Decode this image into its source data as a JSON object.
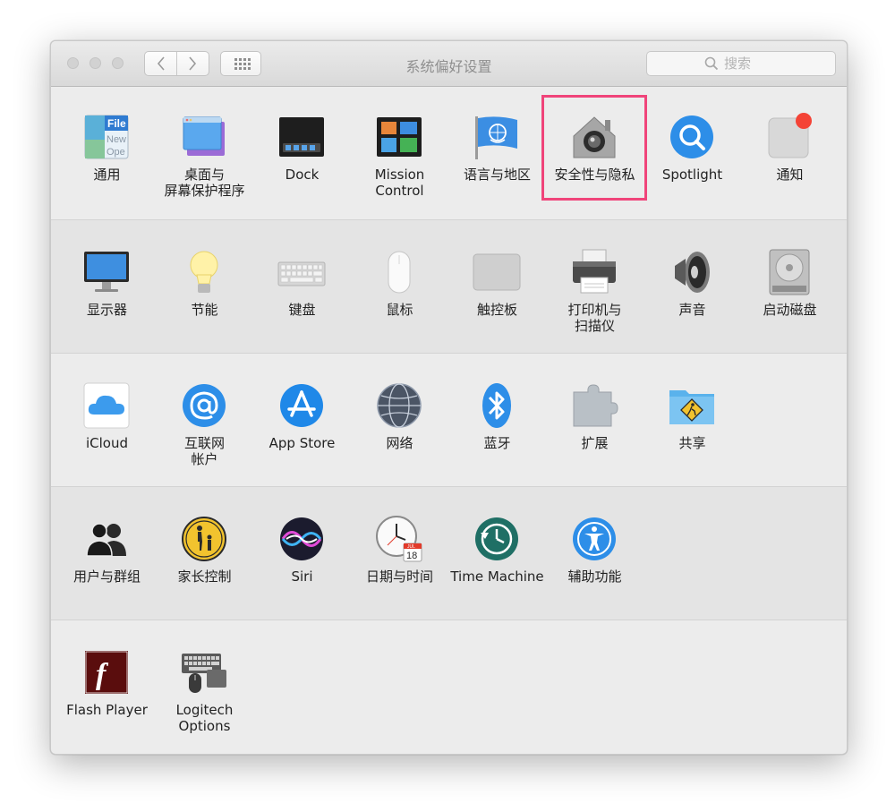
{
  "window": {
    "title": "系统偏好设置",
    "nav": {
      "back": "‹",
      "forward": "›",
      "grid": "⋮⋮⋮"
    },
    "search": {
      "placeholder": "搜索",
      "value": ""
    }
  },
  "colors": {
    "highlight": "#f0447a",
    "notification_dot": "#f44336"
  },
  "sections": [
    {
      "items": [
        {
          "label": "通用",
          "icon": "general-icon"
        },
        {
          "label": "桌面与\n屏幕保护程序",
          "icon": "desktop-screensaver-icon"
        },
        {
          "label": "Dock",
          "icon": "dock-icon"
        },
        {
          "label": "Mission\nControl",
          "icon": "mission-control-icon"
        },
        {
          "label": "语言与地区",
          "icon": "language-region-icon"
        },
        {
          "label": "安全性与隐私",
          "icon": "security-privacy-icon",
          "selected": true
        },
        {
          "label": "Spotlight",
          "icon": "spotlight-icon"
        },
        {
          "label": "通知",
          "icon": "notifications-icon"
        }
      ]
    },
    {
      "items": [
        {
          "label": "显示器",
          "icon": "displays-icon"
        },
        {
          "label": "节能",
          "icon": "energy-saver-icon"
        },
        {
          "label": "键盘",
          "icon": "keyboard-icon"
        },
        {
          "label": "鼠标",
          "icon": "mouse-icon"
        },
        {
          "label": "触控板",
          "icon": "trackpad-icon"
        },
        {
          "label": "打印机与\n扫描仪",
          "icon": "printer-scanner-icon"
        },
        {
          "label": "声音",
          "icon": "sound-icon"
        },
        {
          "label": "启动磁盘",
          "icon": "startup-disk-icon"
        }
      ]
    },
    {
      "items": [
        {
          "label": "iCloud",
          "icon": "icloud-icon"
        },
        {
          "label": "互联网\n帐户",
          "icon": "internet-accounts-icon"
        },
        {
          "label": "App Store",
          "icon": "app-store-icon"
        },
        {
          "label": "网络",
          "icon": "network-icon"
        },
        {
          "label": "蓝牙",
          "icon": "bluetooth-icon"
        },
        {
          "label": "扩展",
          "icon": "extensions-icon"
        },
        {
          "label": "共享",
          "icon": "sharing-icon"
        }
      ]
    },
    {
      "items": [
        {
          "label": "用户与群组",
          "icon": "users-groups-icon"
        },
        {
          "label": "家长控制",
          "icon": "parental-controls-icon"
        },
        {
          "label": "Siri",
          "icon": "siri-icon"
        },
        {
          "label": "日期与时间",
          "icon": "date-time-icon"
        },
        {
          "label": "Time Machine",
          "icon": "time-machine-icon"
        },
        {
          "label": "辅助功能",
          "icon": "accessibility-icon"
        }
      ]
    },
    {
      "items": [
        {
          "label": "Flash Player",
          "icon": "flash-player-icon"
        },
        {
          "label": "Logitech Options",
          "icon": "logitech-options-icon"
        }
      ]
    }
  ],
  "icon_text": {
    "general_file": "File",
    "general_new": "New",
    "general_open": "Ope",
    "flash_glyph": "f",
    "calendar_month": "JUL",
    "calendar_day": "18"
  }
}
